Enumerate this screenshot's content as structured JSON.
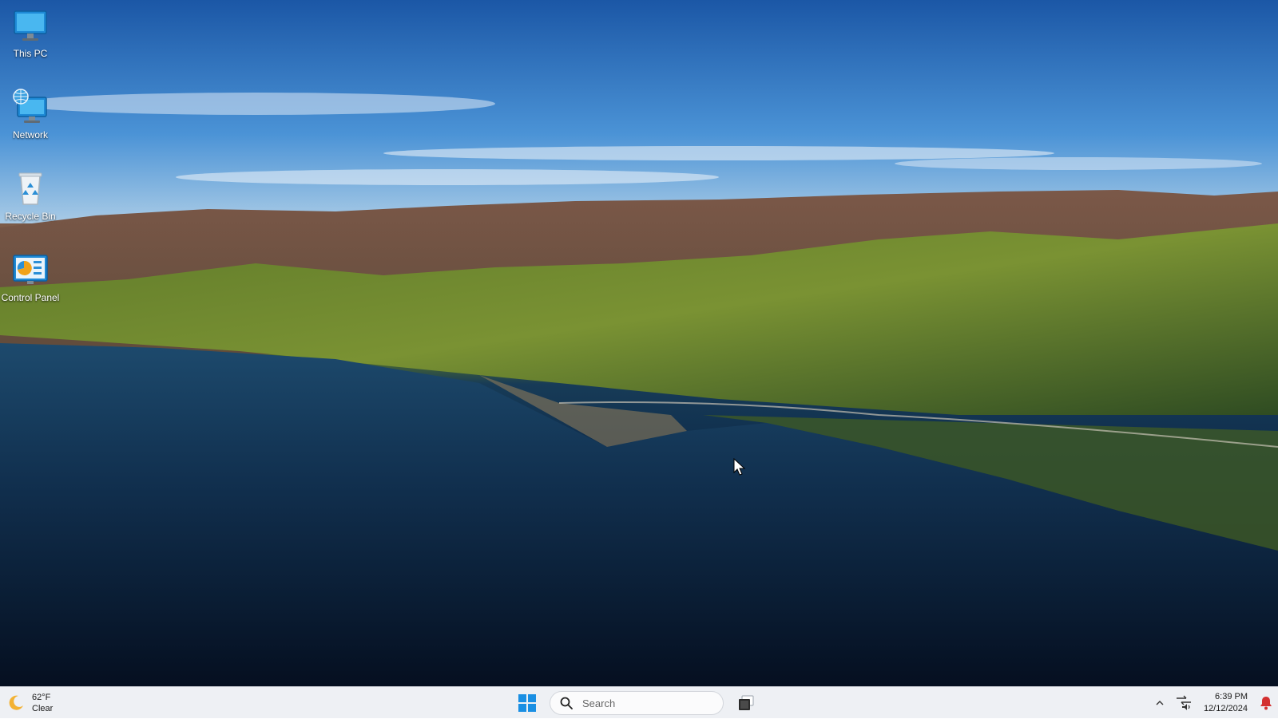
{
  "desktop": {
    "icons": [
      {
        "label": "This PC",
        "icon": "monitor-icon"
      },
      {
        "label": "Network",
        "icon": "network-icon"
      },
      {
        "label": "Recycle Bin",
        "icon": "recycle-bin-icon"
      },
      {
        "label": "Control Panel",
        "icon": "control-panel-icon"
      }
    ],
    "wallpaper": "coastline-landscape"
  },
  "taskbar": {
    "weather": {
      "temperature": "62°F",
      "condition": "Clear",
      "icon": "moon-icon"
    },
    "start_icon": "windows-logo-icon",
    "search": {
      "placeholder": "Search",
      "value": ""
    },
    "taskview_icon": "task-view-icon",
    "tray": {
      "overflow_icon": "chevron-up-icon",
      "network_volume_icon": "network-volume-icon",
      "time": "6:39 PM",
      "date": "12/12/2024",
      "notification_icon": "bell-icon"
    }
  },
  "colors": {
    "taskbar_bg": "#eef0f4",
    "accent_blue": "#0a7fe0",
    "notification_red": "#d32f2f"
  }
}
